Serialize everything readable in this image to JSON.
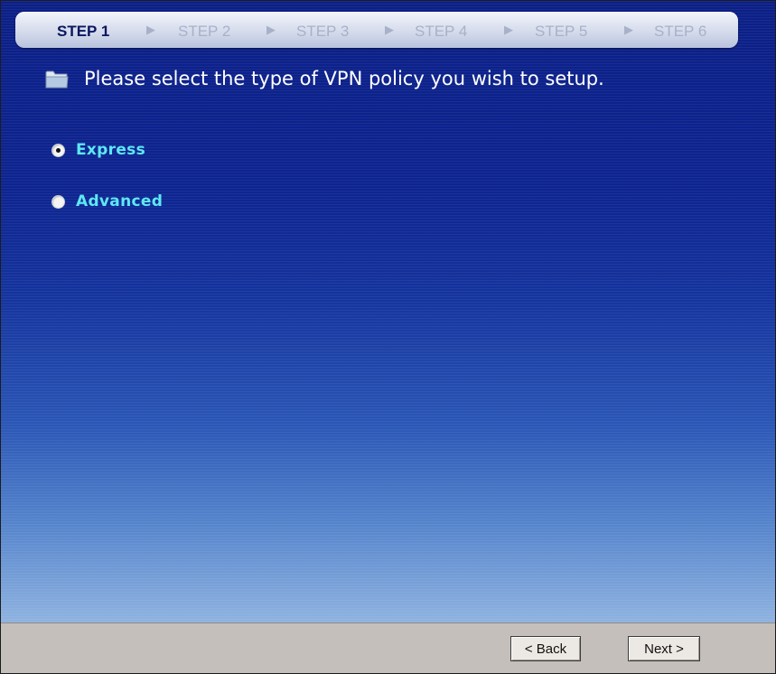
{
  "steps": [
    "STEP 1",
    "STEP 2",
    "STEP 3",
    "STEP 4",
    "STEP 5",
    "STEP 6"
  ],
  "step_separator": "▶",
  "active_step": "STEP 1",
  "heading": {
    "icon": "folder-icon",
    "text": "Please select the type of VPN policy you wish to setup."
  },
  "options": [
    {
      "label": "Express",
      "selected": true
    },
    {
      "label": "Advanced",
      "selected": false
    }
  ],
  "buttons": {
    "back": "< Back",
    "next": "Next >"
  },
  "colors": {
    "active_step": "#0a1760",
    "inactive_step": "#a7b1c9",
    "option_label": "#5ee8f4",
    "panel_top": "#0c1f86",
    "panel_bottom": "#8fb3e0",
    "footer": "#c4bfbb"
  }
}
